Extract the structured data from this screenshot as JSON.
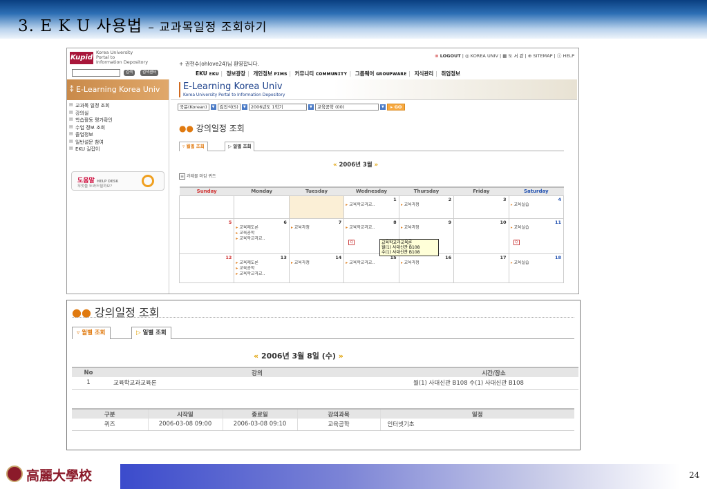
{
  "slide": {
    "title_main": "3. E K U 사용법",
    "title_sub": "– 교과목일정 조회하기",
    "page_number": "24",
    "university_name": "高麗大學校"
  },
  "screen1": {
    "logo_text": "Kupid",
    "logo_lines": [
      "Korea University",
      "Portal to",
      "Information Depository"
    ],
    "welcome": "+ 권현수(ohlove24)님 환영합니다.",
    "util": {
      "logout": "LOGOUT",
      "korea_univ": "KOREA UNIV",
      "library": "도 서 관",
      "sitemap": "SITEMAP",
      "help": "HELP"
    },
    "search_btn1": "검색",
    "search_btn2": "검색센터",
    "nav": [
      "EKU ᴇᴋᴜ",
      "정보광장",
      "개인정보 ᴘɪᴍs",
      "커뮤니티 ᴄᴏᴍᴍᴜɴɪᴛʏ",
      "그룹웨어 ɢʀᴏᴜᴘᴡᴀʀᴇ",
      "지식관리",
      "취업정보"
    ],
    "side_header": "⁑ E-Learning Korea Univ",
    "side_menu": [
      "교과목 일정 조회",
      "강의실",
      "학습활동 평가확인",
      "수업 정보 조회",
      "졸업정보",
      "일반설문 참여",
      "EKU 길잡이"
    ],
    "help_title": "도움말",
    "help_title_small": "HELP DESK",
    "help_desc": "무엇을 도와드릴까요?",
    "banner_title": "E-Learning Korea Univ",
    "banner_sub": "Korea University Portal to Information Depository",
    "filters": [
      "국문(Korean)",
      "김진석(S)",
      "2006년도 1학기",
      "교육공학 (00)"
    ],
    "go_label": "▸ GO",
    "heading": "강의일정 조회",
    "tab_monthly": "▿ 월별 조회",
    "tab_daily": "▷ 일별 조회",
    "month_label": "2006년 3월",
    "legend": "과제물 마감   퀴즈",
    "weekdays": [
      "Sunday",
      "Monday",
      "Tuesday",
      "Wednesday",
      "Thursday",
      "Friday",
      "Saturday"
    ],
    "weeks": [
      [
        {
          "day": "",
          "events": []
        },
        {
          "day": "",
          "events": []
        },
        {
          "day": "",
          "events": [],
          "today": true
        },
        {
          "day": "1",
          "events": [
            "교육학교과교.."
          ]
        },
        {
          "day": "2",
          "events": [
            "교육과정"
          ]
        },
        {
          "day": "3",
          "events": []
        },
        {
          "day": "4",
          "events": [
            "교육실습"
          ]
        }
      ],
      [
        {
          "day": "5",
          "events": []
        },
        {
          "day": "6",
          "events": [
            "교육제도론",
            "교육공학",
            "교육학교과교.."
          ]
        },
        {
          "day": "7",
          "events": [
            "교육과정"
          ]
        },
        {
          "day": "8",
          "events": [
            "교육학교과교.."
          ],
          "quiz": true
        },
        {
          "day": "9",
          "events": [
            "교육과정"
          ]
        },
        {
          "day": "10",
          "events": []
        },
        {
          "day": "11",
          "events": [
            "교육실습"
          ],
          "quiz": true
        }
      ],
      [
        {
          "day": "12",
          "events": []
        },
        {
          "day": "13",
          "events": [
            "교육제도론",
            "교육공학",
            "교육학교과교.."
          ]
        },
        {
          "day": "14",
          "events": [
            "교육과정"
          ]
        },
        {
          "day": "15",
          "events": [
            "교육학교과교.."
          ]
        },
        {
          "day": "16",
          "events": [
            "교육과정"
          ]
        },
        {
          "day": "17",
          "events": []
        },
        {
          "day": "18",
          "events": [
            "교육실습"
          ]
        }
      ]
    ],
    "tooltip": [
      "교육학교과교육론",
      "월(1) 사대신관 B108",
      "수(1) 사대신관 B108"
    ]
  },
  "screen2": {
    "heading": "강의일정 조회",
    "tab_monthly": "월별 조회",
    "tab_daily": "일별 조회",
    "date_label": "2006년 3월 8일 (수)",
    "table1": {
      "headers": [
        "No",
        "강의",
        "시간/장소"
      ],
      "rows": [
        [
          "1",
          "교육학교과교육론",
          "월(1) 사대신관 B108 수(1) 사대신관 B108"
        ]
      ]
    },
    "table2": {
      "headers": [
        "구분",
        "시작일",
        "종료일",
        "강의과목",
        "일정"
      ],
      "rows": [
        [
          "퀴즈",
          "2006-03-08 09:00",
          "2006-03-08 09:10",
          "교육공학",
          "인터넷기초"
        ]
      ]
    }
  }
}
